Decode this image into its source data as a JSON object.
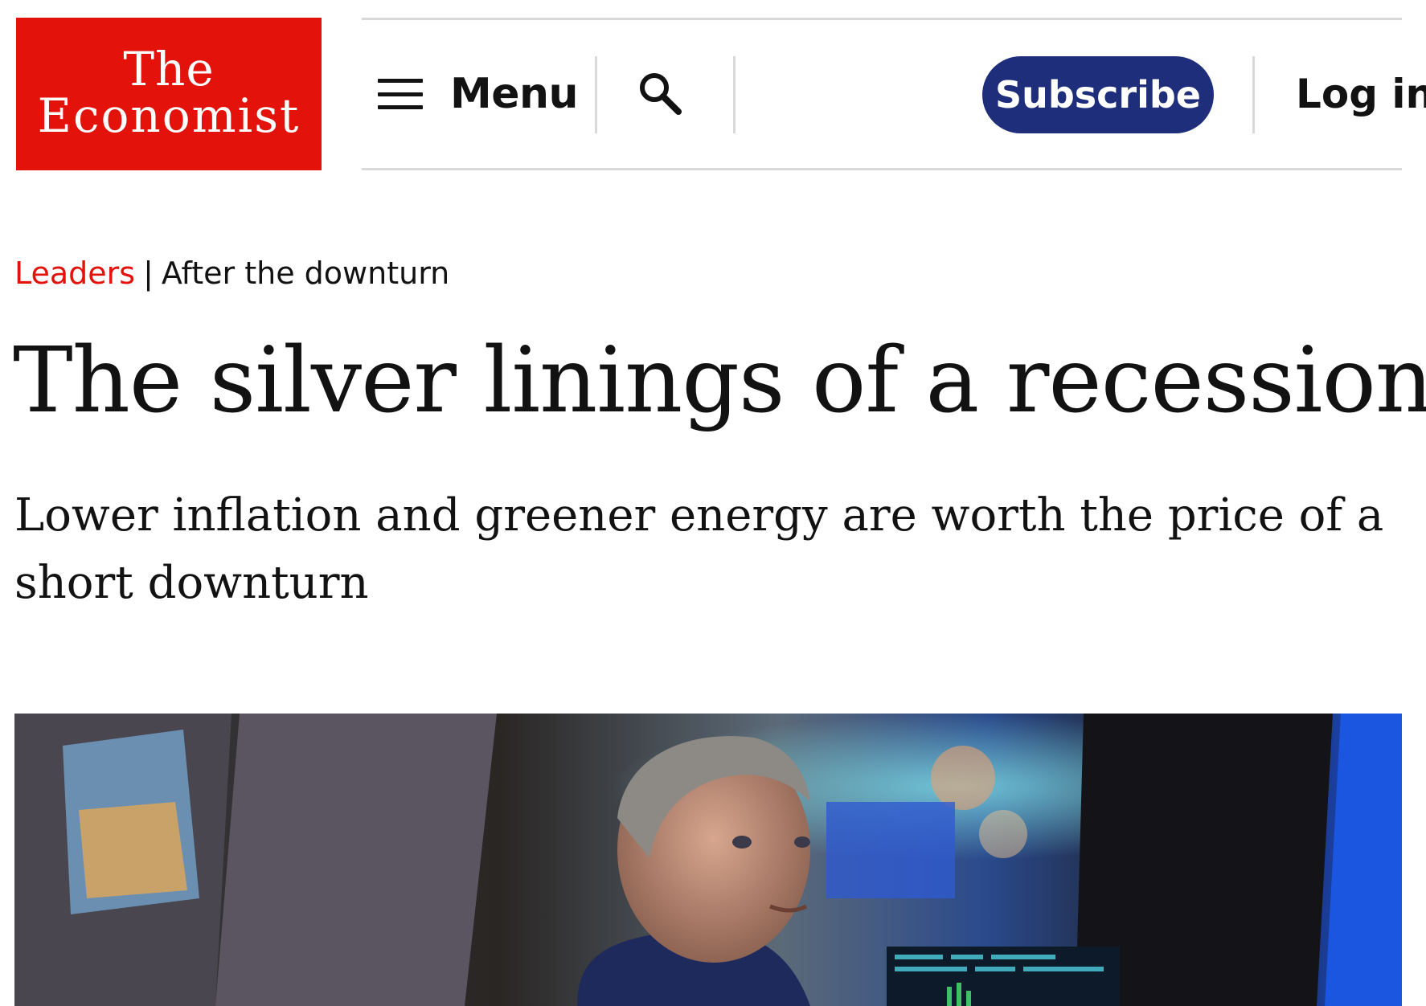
{
  "header": {
    "logo": {
      "line1": "The",
      "line2": "Economist"
    },
    "menu_label": "Menu",
    "subscribe_label": "Subscribe",
    "login_label": "Log in"
  },
  "article": {
    "section": "Leaders",
    "separator": "|",
    "topic": "After the downturn",
    "headline": "The silver linings of a recession",
    "subheadline": "Lower inflation and greener energy are worth the price of a short downturn"
  },
  "colors": {
    "brand_red": "#e3120b",
    "subscribe_blue": "#1f2e7a",
    "rule_grey": "#d9d9d9"
  },
  "icons": {
    "menu": "hamburger-icon",
    "search": "search-icon"
  }
}
